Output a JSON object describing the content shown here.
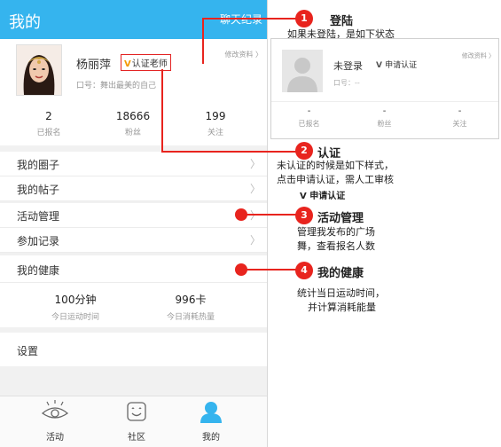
{
  "header": {
    "title": "我的",
    "right_link": "聊天纪录"
  },
  "profile": {
    "name": "杨丽萍",
    "cert_badge": "认证老师",
    "edit_link": "修改资料 〉",
    "slogan": "口号：舞出最美的自己"
  },
  "stats": [
    {
      "value": "2",
      "label": "已报名"
    },
    {
      "value": "18666",
      "label": "粉丝"
    },
    {
      "value": "199",
      "label": "关注"
    }
  ],
  "menu": [
    {
      "label": "我的圈子"
    },
    {
      "label": "我的帖子"
    },
    {
      "label": "活动管理"
    },
    {
      "label": "参加记录"
    }
  ],
  "health": {
    "title": "我的健康",
    "items": [
      {
        "value": "100分钟",
        "label": "今日运动时间"
      },
      {
        "value": "996卡",
        "label": "今日消耗热量"
      }
    ]
  },
  "settings": {
    "label": "设置"
  },
  "tabs": [
    {
      "label": "活动",
      "icon": "eye-icon"
    },
    {
      "label": "社区",
      "icon": "smile-icon"
    },
    {
      "label": "我的",
      "icon": "user-icon",
      "active": true
    }
  ],
  "annotations": [
    {
      "num": "1",
      "title": "登陆",
      "desc": "如果未登陆，是如下状态"
    },
    {
      "num": "2",
      "title": "认证",
      "desc_lines": [
        "未认证的时候是如下样式，",
        "点击申请认证，需人工审核"
      ],
      "sample": "申请认证"
    },
    {
      "num": "3",
      "title": "活动管理",
      "desc_lines": [
        "管理我发布的广场",
        "舞，查看报名人数"
      ]
    },
    {
      "num": "4",
      "title": "我的健康",
      "desc_lines": [
        "统计当日运动时间，",
        "并计算消耗能量"
      ]
    }
  ],
  "logged_out_card": {
    "name": "未登录",
    "apply_btn": "申请认证",
    "edit_link": "修改资料 〉",
    "slogan": "口号：--",
    "stats": [
      {
        "value": "-",
        "label": "已报名"
      },
      {
        "value": "-",
        "label": "粉丝"
      },
      {
        "value": "-",
        "label": "关注"
      }
    ]
  },
  "colors": {
    "header": "#35b4ee",
    "annotation_red": "#e8241e",
    "badge_v": "#f39800"
  }
}
